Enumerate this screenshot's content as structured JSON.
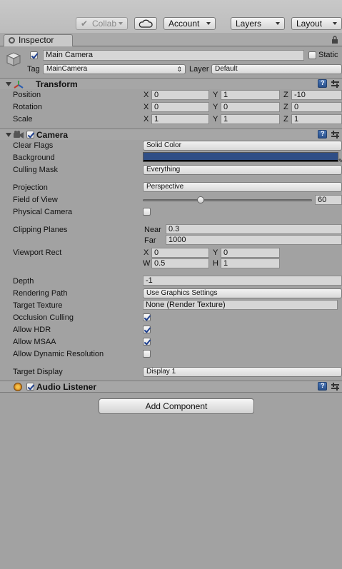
{
  "toolbar": {
    "collab": "Collab",
    "account": "Account",
    "layers": "Layers",
    "layout": "Layout"
  },
  "tab": {
    "label": "Inspector"
  },
  "object": {
    "name": "Main Camera",
    "static_label": "Static",
    "tag_label": "Tag",
    "tag_value": "MainCamera",
    "layer_label": "Layer",
    "layer_value": "Default",
    "active": true
  },
  "transform": {
    "title": "Transform",
    "rows": [
      {
        "label": "Position",
        "x": "0",
        "y": "1",
        "z": "-10"
      },
      {
        "label": "Rotation",
        "x": "0",
        "y": "0",
        "z": "0"
      },
      {
        "label": "Scale",
        "x": "1",
        "y": "1",
        "z": "1"
      }
    ],
    "axis_x": "X",
    "axis_y": "Y",
    "axis_z": "Z"
  },
  "camera": {
    "title": "Camera",
    "clear_flags_label": "Clear Flags",
    "clear_flags_value": "Solid Color",
    "background_label": "Background",
    "background_color": "#2f4e86",
    "culling_mask_label": "Culling Mask",
    "culling_mask_value": "Everything",
    "projection_label": "Projection",
    "projection_value": "Perspective",
    "fov_label": "Field of View",
    "fov_value": "60",
    "fov_fraction": 0.33,
    "physical_label": "Physical Camera",
    "clipping_label": "Clipping Planes",
    "near_label": "Near",
    "near_value": "0.3",
    "far_label": "Far",
    "far_value": "1000",
    "viewport_label": "Viewport Rect",
    "vp_x_label": "X",
    "vp_x": "0",
    "vp_y_label": "Y",
    "vp_y": "0",
    "vp_w_label": "W",
    "vp_w": "0.5",
    "vp_h_label": "H",
    "vp_h": "1",
    "depth_label": "Depth",
    "depth_value": "-1",
    "rendering_path_label": "Rendering Path",
    "rendering_path_value": "Use Graphics Settings",
    "target_texture_label": "Target Texture",
    "target_texture_value": "None (Render Texture)",
    "occlusion_label": "Occlusion Culling",
    "hdr_label": "Allow HDR",
    "msaa_label": "Allow MSAA",
    "dynres_label": "Allow Dynamic Resolution",
    "target_display_label": "Target Display",
    "target_display_value": "Display 1"
  },
  "audio": {
    "title": "Audio Listener"
  },
  "add_component": "Add Component"
}
